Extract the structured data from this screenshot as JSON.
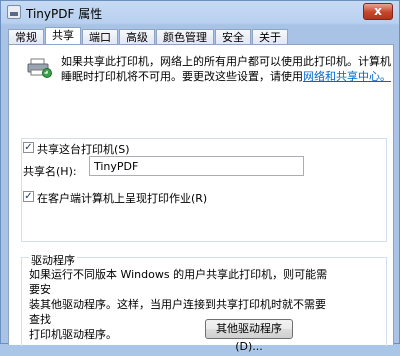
{
  "window": {
    "title": "TinyPDF 属性",
    "close_glyph": "x"
  },
  "tabs": [
    {
      "label": "常规"
    },
    {
      "label": "共享"
    },
    {
      "label": "端口"
    },
    {
      "label": "高级"
    },
    {
      "label": "颜色管理"
    },
    {
      "label": "安全"
    },
    {
      "label": "关于"
    }
  ],
  "sharing": {
    "info_line1": "如果共享此打印机，网络上的所有用户都可以使用此打印机。计算机",
    "info_line2": "睡眠时打印机将不可用。要更改这些设置，请使用",
    "info_link": "网络和共享中心。",
    "share_checkbox_label": "共享这台打印机(S)",
    "share_checked": true,
    "share_name_label": "共享名(H):",
    "share_name_value": "TinyPDF",
    "render_checkbox_label": "在客户端计算机上呈现打印作业(R)",
    "render_checked": true
  },
  "drivers": {
    "title": "驱动程序",
    "text_line1": "如果运行不同版本 Windows 的用户共享此打印机，则可能需要安",
    "text_line2": "装其他驱动程序。这样，当用户连接到共享打印机时就不需要查找",
    "text_line3": "打印机驱动程序。",
    "button_label": "其他驱动程序(D)..."
  }
}
